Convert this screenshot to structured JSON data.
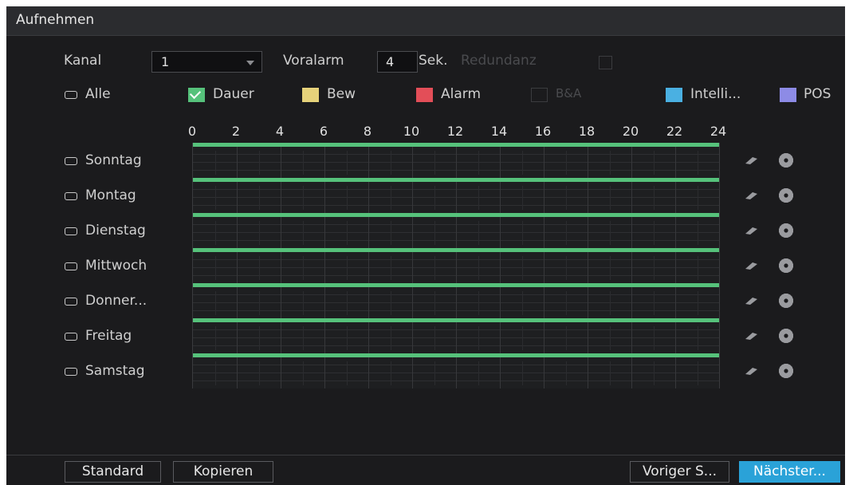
{
  "title": "Aufnehmen",
  "settings": {
    "kanal_label": "Kanal",
    "kanal_value": "1",
    "voralarm_label": "Voralarm",
    "voralarm_value": "4",
    "sek_label": "Sek.",
    "redundanz_label": "Redundanz"
  },
  "legend": {
    "alle": "Alle",
    "items": [
      {
        "label": "Dauer",
        "color": "#56c27b",
        "checked": true
      },
      {
        "label": "Bew",
        "color": "#e6d27a"
      },
      {
        "label": "Alarm",
        "color": "#e34e58"
      },
      {
        "label": "B&A",
        "color": "",
        "disabled": true
      },
      {
        "label": "Intelli...",
        "color": "#4ab0e2"
      },
      {
        "label": "POS",
        "color": "#8d8be6"
      }
    ]
  },
  "hours": [
    "0",
    "2",
    "4",
    "6",
    "8",
    "10",
    "12",
    "14",
    "16",
    "18",
    "20",
    "22",
    "24"
  ],
  "days": [
    {
      "label": "Sonntag",
      "schedule": [
        [
          0,
          24,
          "Dauer"
        ]
      ]
    },
    {
      "label": "Montag",
      "schedule": [
        [
          0,
          24,
          "Dauer"
        ]
      ]
    },
    {
      "label": "Dienstag",
      "schedule": [
        [
          0,
          24,
          "Dauer"
        ]
      ]
    },
    {
      "label": "Mittwoch",
      "schedule": [
        [
          0,
          24,
          "Dauer"
        ]
      ]
    },
    {
      "label": "Donner...",
      "schedule": [
        [
          0,
          24,
          "Dauer"
        ]
      ]
    },
    {
      "label": "Freitag",
      "schedule": [
        [
          0,
          24,
          "Dauer"
        ]
      ]
    },
    {
      "label": "Samstag",
      "schedule": [
        [
          0,
          24,
          "Dauer"
        ]
      ]
    }
  ],
  "icons": {
    "row_clear": "eraser-icon",
    "row_settings": "gear-icon"
  },
  "buttons": {
    "standard": "Standard",
    "kopieren": "Kopieren",
    "voriger": "Voriger S...",
    "naechster": "Nächster..."
  },
  "colors": {
    "accent": "#2aa2d8",
    "dauer": "#56c27b"
  }
}
